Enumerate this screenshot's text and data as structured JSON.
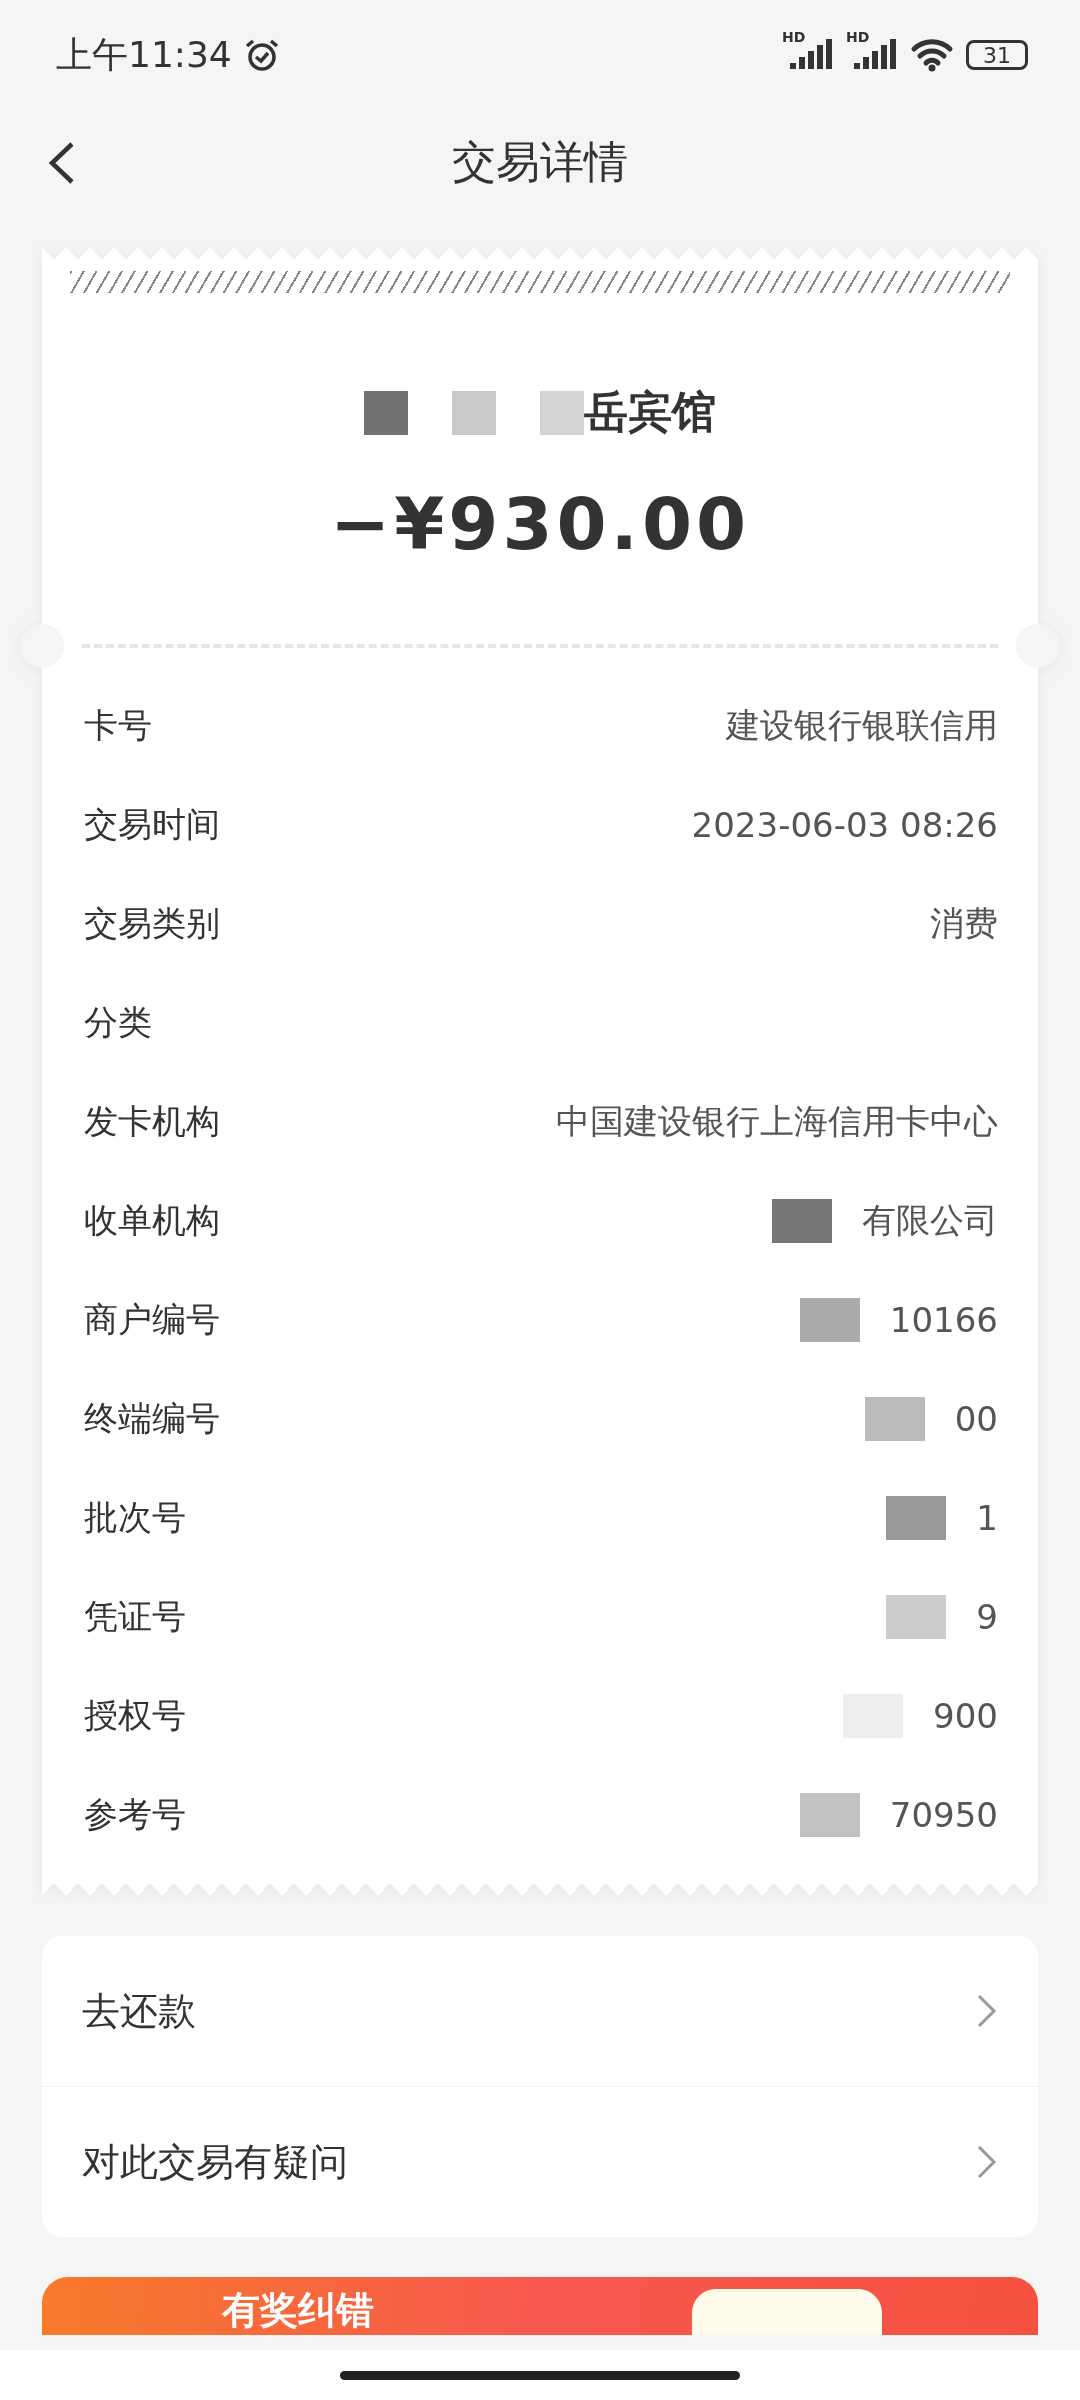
{
  "status_bar": {
    "time": "上午11:34",
    "signal_labels": [
      "HD",
      "HD"
    ],
    "battery": "31"
  },
  "header": {
    "title": "交易详情"
  },
  "receipt": {
    "merchant": "岳宾馆",
    "amount": "−¥930.00",
    "rows": [
      {
        "label": "卡号",
        "value": "建设银行银联信用"
      },
      {
        "label": "交易时间",
        "value": "2023-06-03 08:26"
      },
      {
        "label": "交易类别",
        "value": "消费"
      },
      {
        "label": "分类"
      },
      {
        "label": "发卡机构",
        "value": "中国建设银行上海信用卡中心"
      },
      {
        "label": "收单机构",
        "value": "有限公司"
      },
      {
        "label": "商户编号",
        "value": "10166"
      },
      {
        "label": "终端编号",
        "value": "00"
      },
      {
        "label": "批次号",
        "value": "1"
      },
      {
        "label": "凭证号",
        "value": "9"
      },
      {
        "label": "授权号",
        "value": "900"
      },
      {
        "label": "参考号",
        "value": "70950"
      }
    ]
  },
  "actions": [
    {
      "label": "去还款"
    },
    {
      "label": "对此交易有疑问"
    }
  ],
  "banner": {
    "title": "有奖纠错"
  }
}
